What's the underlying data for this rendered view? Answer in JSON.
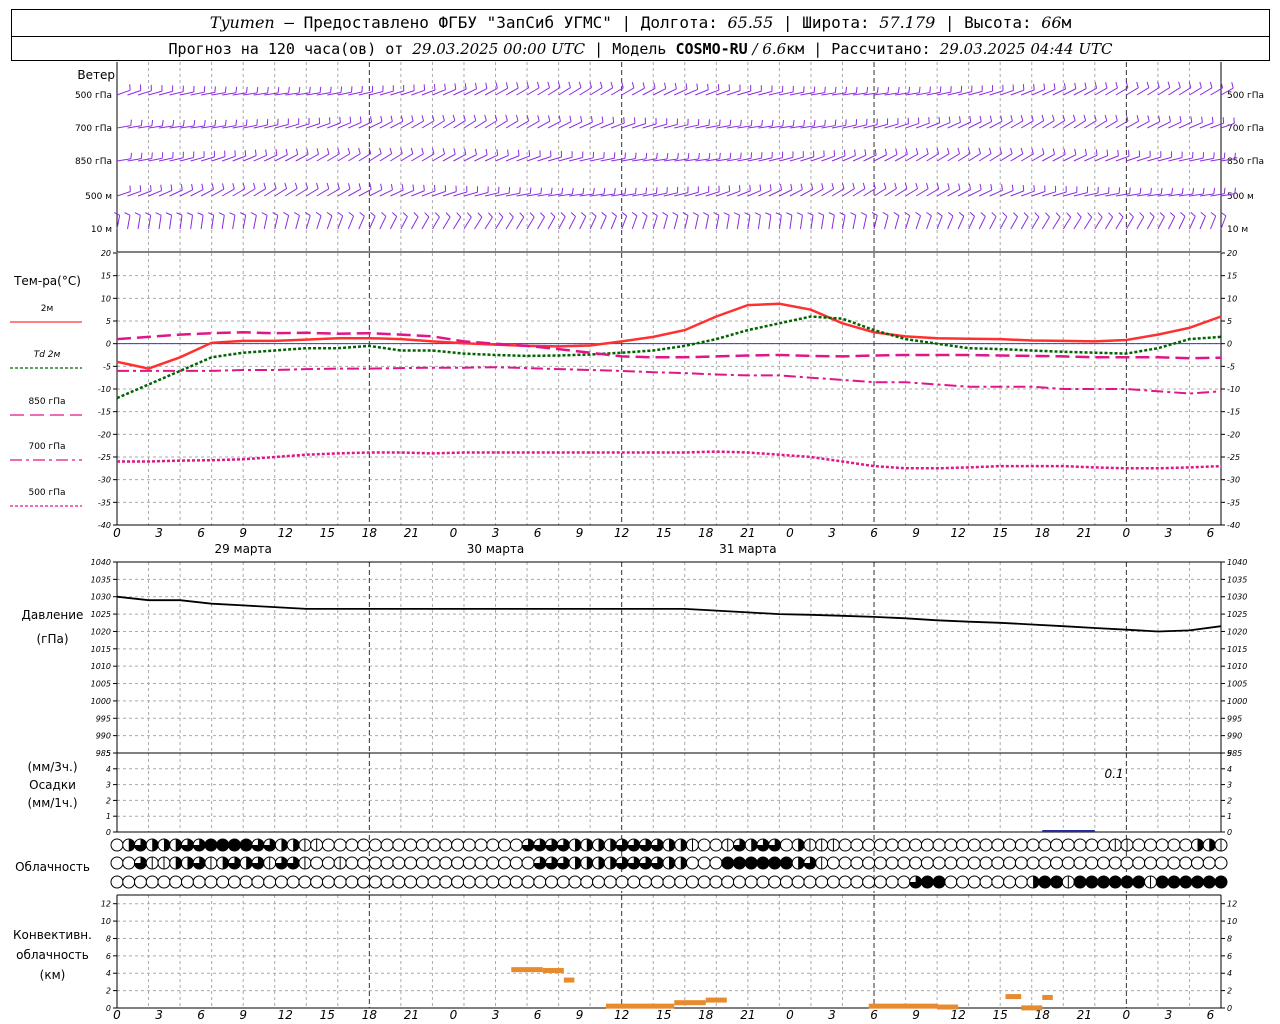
{
  "header": {
    "station": "Tyumen",
    "provider": " – Предоставлено ФГБУ \"ЗапСиб УГМС\" | Долгота: ",
    "lon": "65.55",
    "lat_label": " | Широта: ",
    "lat": "57.179",
    "alt_label": " | Высота: ",
    "alt": "66",
    "alt_unit": "м",
    "forecast_prefix": "Прогноз на 120 часа(ов) от ",
    "forecast_start": "29.03.2025 00:00 UTC",
    "model_label": "  | Модель ",
    "model": "COSMO-RU",
    "resolution": " / 6.6",
    "res_unit": "км",
    "calc_label": " | Рассчитано: ",
    "calc_time": "29.03.2025 04:44 UTC"
  },
  "labels": {
    "wind": "Ветер",
    "wind_levels": [
      "500 гПа",
      "700 гПа",
      "850 гПа",
      "500 м",
      "10  м"
    ],
    "temp_title": "Тем-ра(°C)",
    "temp_legend": [
      "2м",
      "Td  2м",
      "850 гПа",
      "700 гПа",
      "500 гПа"
    ],
    "pressure": [
      "Давление",
      "(гПа)"
    ],
    "precip": [
      "(мм/3ч.)",
      "Осадки",
      "(мм/1ч.)"
    ],
    "clouds": "Облачность",
    "conv": [
      "Конвективн.",
      "облачность",
      "(км)"
    ],
    "precip_value": "0.1"
  },
  "colors": {
    "wind": "#8a2be2",
    "t2m": "#ff3030",
    "td2m": "#006400",
    "t850": "#e0158a",
    "t700": "#e0158a",
    "t500": "#e0158a",
    "pressure": "#000000",
    "conv": "#e88a2e",
    "zero_line": "#3333ff"
  },
  "chart_data": [
    {
      "type": "line",
      "name": "temperature",
      "xlabel": "",
      "ylabel": "Тем-ра(°C)",
      "ylim": [
        -40,
        20
      ],
      "yticks": [
        20,
        15,
        10,
        5,
        0,
        -5,
        -10,
        -15,
        -20,
        -25,
        -30,
        -35,
        -40
      ],
      "x_hours": [
        0,
        6,
        12,
        18,
        24,
        30,
        36,
        42,
        48,
        54,
        60,
        66,
        72,
        78,
        84,
        90,
        96,
        102,
        108,
        114,
        120
      ],
      "x_tick_labels": [
        "0",
        "3",
        "6",
        "9",
        "12",
        "15",
        "18",
        "21",
        "0",
        "3",
        "6",
        "9",
        "12",
        "15",
        "18",
        "21",
        "0",
        "3",
        "6",
        "9",
        "12",
        "15",
        "18",
        "21",
        "0",
        "3",
        "6"
      ],
      "day_labels": [
        "29 марта",
        "30 марта",
        "31 марта"
      ],
      "series": [
        {
          "name": "2м",
          "key": "t2m",
          "x": [
            0,
            3,
            6,
            9,
            12,
            15,
            18,
            21,
            24,
            27,
            30,
            33,
            36,
            39,
            42,
            45,
            48,
            51,
            54,
            57,
            60,
            63,
            66,
            69,
            72,
            75,
            78,
            81,
            84,
            87,
            90,
            93,
            96,
            99,
            102,
            105
          ],
          "values": [
            -4,
            -5.5,
            -3,
            0.2,
            0.6,
            0.6,
            0.9,
            1.2,
            1.2,
            1.0,
            0.5,
            0.1,
            -0.2,
            -0.5,
            -0.6,
            -0.4,
            0.5,
            1.5,
            3,
            6,
            8.5,
            8.8,
            7.5,
            4.5,
            2.5,
            1.6,
            1.2,
            1.1,
            1.0,
            0.7,
            0.6,
            0.5,
            0.8,
            2,
            3.5,
            6
          ]
        },
        {
          "name": "Td  2м",
          "key": "td2m",
          "x": [
            0,
            3,
            6,
            9,
            12,
            15,
            18,
            21,
            24,
            27,
            30,
            33,
            36,
            39,
            42,
            45,
            48,
            51,
            54,
            57,
            60,
            63,
            66,
            69,
            72,
            75,
            78,
            81,
            84,
            87,
            90,
            93,
            96,
            99,
            102,
            105
          ],
          "values": [
            -12,
            -9,
            -6,
            -3,
            -2,
            -1.5,
            -1,
            -1,
            -0.5,
            -1.5,
            -1.5,
            -2.2,
            -2.5,
            -2.7,
            -2.6,
            -2.4,
            -2,
            -1.5,
            -0.5,
            1,
            3,
            4.5,
            6,
            5.5,
            3,
            1,
            0,
            -1,
            -1.2,
            -1.5,
            -1.8,
            -2,
            -2.2,
            -1,
            1,
            1.5
          ]
        },
        {
          "name": "850 гПа",
          "key": "t850",
          "x": [
            0,
            3,
            6,
            9,
            12,
            15,
            18,
            21,
            24,
            27,
            30,
            33,
            36,
            39,
            42,
            45,
            48,
            51,
            54,
            57,
            60,
            63,
            66,
            69,
            72,
            75,
            78,
            81,
            84,
            87,
            90,
            93,
            96,
            99,
            102,
            105
          ],
          "values": [
            1,
            1.5,
            2,
            2.3,
            2.5,
            2.3,
            2.4,
            2.2,
            2.3,
            2.0,
            1.6,
            0.5,
            0,
            -0.5,
            -1.2,
            -2,
            -2.8,
            -3,
            -3,
            -2.8,
            -2.6,
            -2.5,
            -2.7,
            -2.8,
            -2.6,
            -2.5,
            -2.5,
            -2.5,
            -2.6,
            -2.7,
            -2.8,
            -3,
            -3,
            -3,
            -3.2,
            -3.1
          ]
        },
        {
          "name": "700 гПа",
          "key": "t700",
          "x": [
            0,
            3,
            6,
            9,
            12,
            15,
            18,
            21,
            24,
            27,
            30,
            33,
            36,
            39,
            42,
            45,
            48,
            51,
            54,
            57,
            60,
            63,
            66,
            69,
            72,
            75,
            78,
            81,
            84,
            87,
            90,
            93,
            96,
            99,
            102,
            105
          ],
          "values": [
            -6,
            -6,
            -6,
            -6,
            -5.8,
            -5.8,
            -5.6,
            -5.5,
            -5.5,
            -5.4,
            -5.3,
            -5.3,
            -5.2,
            -5.4,
            -5.6,
            -5.8,
            -6,
            -6.3,
            -6.5,
            -6.8,
            -7,
            -7,
            -7.5,
            -8,
            -8.5,
            -8.5,
            -9,
            -9.5,
            -9.5,
            -9.5,
            -10,
            -10,
            -10,
            -10.5,
            -11,
            -10.5
          ]
        },
        {
          "name": "500 гПа",
          "key": "t500",
          "x": [
            0,
            3,
            6,
            9,
            12,
            15,
            18,
            21,
            24,
            27,
            30,
            33,
            36,
            39,
            42,
            45,
            48,
            51,
            54,
            57,
            60,
            63,
            66,
            69,
            72,
            75,
            78,
            81,
            84,
            87,
            90,
            93,
            96,
            99,
            102,
            105
          ],
          "values": [
            -26,
            -26,
            -25.8,
            -25.7,
            -25.5,
            -25,
            -24.5,
            -24.2,
            -24,
            -24,
            -24.2,
            -24,
            -24,
            -24,
            -24,
            -24,
            -24,
            -24,
            -24,
            -23.8,
            -24,
            -24.5,
            -25,
            -26,
            -27,
            -27.5,
            -27.5,
            -27.3,
            -27,
            -27,
            -27,
            -27.3,
            -27.5,
            -27.5,
            -27.3,
            -27
          ]
        }
      ]
    },
    {
      "type": "line",
      "name": "pressure",
      "ylabel": "Давление (гПа)",
      "ylim": [
        985,
        1040
      ],
      "yticks": [
        1040,
        1035,
        1030,
        1025,
        1020,
        1015,
        1010,
        1005,
        1000,
        995,
        990,
        985
      ],
      "x": [
        0,
        3,
        6,
        9,
        12,
        15,
        18,
        21,
        24,
        27,
        30,
        33,
        36,
        39,
        42,
        45,
        48,
        51,
        54,
        57,
        60,
        63,
        66,
        69,
        72,
        75,
        78,
        81,
        84,
        87,
        90,
        93,
        96,
        99,
        102,
        105,
        108,
        111,
        114,
        117,
        120
      ],
      "values": [
        1030,
        1029,
        1029,
        1028,
        1027.5,
        1027,
        1026.5,
        1026.5,
        1026.5,
        1026.5,
        1026.5,
        1026.5,
        1026.5,
        1026.5,
        1026.5,
        1026.5,
        1026.5,
        1026.5,
        1026.5,
        1026,
        1025.5,
        1025,
        1024.8,
        1024.5,
        1024.2,
        1023.8,
        1023.2,
        1022.8,
        1022.5,
        1022,
        1021.5,
        1021,
        1020.5,
        1020,
        1020.3,
        1021.5,
        1022.5,
        1023.5,
        1024.5,
        1025.5,
        1026
      ]
    },
    {
      "type": "bar",
      "name": "precipitation",
      "ylabel": "Осадки",
      "ylim": [
        0,
        5
      ],
      "yticks": [
        5,
        4,
        3,
        2,
        1,
        0
      ]
    },
    {
      "type": "bar",
      "name": "convective_clouds",
      "ylabel": "Конвективн. облачность (км)",
      "ylim": [
        0,
        13
      ],
      "yticks": [
        12,
        10,
        8,
        6,
        4,
        2,
        0
      ],
      "bars": [
        {
          "x0": 37.5,
          "x1": 40.5,
          "base": 0,
          "top": 4.7
        },
        {
          "x0": 40.5,
          "x1": 42.5,
          "base": 0,
          "top": 4.6
        },
        {
          "x0": 42.5,
          "x1": 43.5,
          "base": 0,
          "top": 3.5
        },
        {
          "x0": 46.5,
          "x1": 53,
          "base": 0,
          "top": 0.5
        },
        {
          "x0": 53,
          "x1": 56,
          "base": 0,
          "top": 0.9
        },
        {
          "x0": 56,
          "x1": 58,
          "base": 0,
          "top": 1.2
        },
        {
          "x0": 71.5,
          "x1": 78,
          "base": 0,
          "top": 0.5
        },
        {
          "x0": 78,
          "x1": 80,
          "base": 0,
          "top": 0.4
        },
        {
          "x0": 84.5,
          "x1": 86,
          "base": 0,
          "top": 1.6
        },
        {
          "x0": 86,
          "x1": 88,
          "base": 0,
          "top": 0.3
        },
        {
          "x0": 88,
          "x1": 89,
          "base": 0,
          "top": 1.5
        }
      ]
    }
  ],
  "clouds": {
    "row_upper": [
      0,
      2,
      3,
      2,
      2,
      2,
      3,
      3,
      4,
      4,
      4,
      4,
      3,
      3,
      2,
      2,
      1,
      1,
      0,
      0,
      0,
      0,
      0,
      0,
      0,
      0,
      0,
      0,
      0,
      0,
      0,
      0,
      0,
      0,
      0,
      3,
      3,
      3,
      3,
      2,
      2,
      2,
      2,
      3,
      3,
      3,
      3,
      2,
      2,
      1,
      0,
      0,
      1,
      3,
      2,
      3,
      3,
      0,
      2,
      1,
      1,
      1,
      0,
      0,
      0,
      0,
      0,
      0,
      0,
      0,
      0,
      0,
      0,
      0,
      0,
      0,
      0,
      0,
      0,
      0,
      0,
      0,
      0,
      0,
      0,
      1,
      1,
      0,
      0,
      0,
      0,
      0,
      2,
      2,
      1
    ],
    "row_middle": [
      0,
      0,
      3,
      1,
      1,
      2,
      2,
      3,
      1,
      2,
      3,
      2,
      3,
      1,
      3,
      3,
      1,
      0,
      0,
      1,
      0,
      0,
      0,
      0,
      0,
      0,
      0,
      0,
      0,
      0,
      0,
      0,
      0,
      0,
      0,
      0,
      3,
      3,
      3,
      2,
      2,
      2,
      2,
      3,
      3,
      3,
      3,
      2,
      2,
      0,
      0,
      0,
      4,
      4,
      4,
      4,
      4,
      4,
      2,
      3,
      1,
      0,
      0,
      0,
      0,
      0,
      0,
      0,
      0,
      0,
      0,
      0,
      0,
      0,
      0,
      0,
      0,
      0,
      0,
      0,
      0,
      0,
      0,
      0,
      0,
      0,
      0,
      0,
      0,
      0,
      0,
      0,
      0,
      0,
      0
    ],
    "row_lower": [
      0,
      0,
      0,
      0,
      0,
      0,
      0,
      0,
      0,
      0,
      0,
      0,
      0,
      0,
      0,
      0,
      0,
      0,
      0,
      0,
      0,
      0,
      0,
      0,
      0,
      0,
      0,
      0,
      0,
      0,
      0,
      0,
      0,
      0,
      0,
      0,
      0,
      0,
      0,
      0,
      0,
      0,
      0,
      0,
      0,
      0,
      0,
      0,
      0,
      0,
      0,
      0,
      0,
      0,
      0,
      0,
      0,
      0,
      0,
      0,
      0,
      0,
      0,
      0,
      0,
      0,
      0,
      0,
      3,
      4,
      4,
      0,
      0,
      0,
      0,
      0,
      0,
      0,
      2,
      4,
      4,
      1,
      4,
      4,
      4,
      4,
      4,
      4,
      1,
      4,
      4,
      4,
      4,
      4,
      4
    ]
  }
}
